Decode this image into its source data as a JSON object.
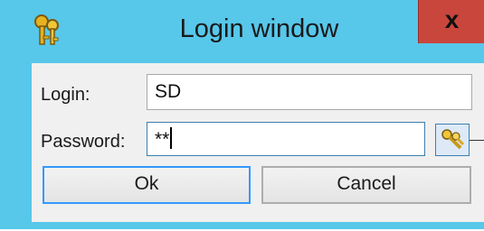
{
  "window": {
    "title": "Login window",
    "close_label": "x",
    "app_icon": "keys-icon"
  },
  "form": {
    "login_label": "Login:",
    "login_value": "SD",
    "password_label": "Password:",
    "password_value": "**",
    "key_button_icon": "keys-icon"
  },
  "buttons": {
    "ok_label": "Ok",
    "cancel_label": "Cancel"
  }
}
